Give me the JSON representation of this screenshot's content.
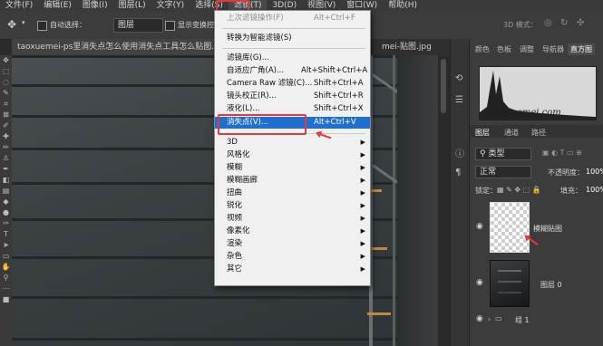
{
  "menubar": {
    "items": [
      "文件(F)",
      "编辑(E)",
      "图像(I)",
      "图层(L)",
      "文字(Y)",
      "选择(S)",
      "滤镜(T)",
      "3D(D)",
      "视图(V)",
      "窗口(W)",
      "帮助(H)"
    ],
    "active": "滤镜(T)"
  },
  "options": {
    "auto_select_label": "自动选择：",
    "layer_select_value": "图层",
    "show_transform_label": "显示变换控件",
    "mode_3d_label": "3D 模式："
  },
  "tabs": {
    "doc_tab": "taoxuemei-ps里消失点怎么使用消失点工具怎么贴图.psd",
    "doc_tab2": "mei-贴图.jpg"
  },
  "filter_menu": {
    "items": [
      {
        "label": "上次滤镜操作(F)",
        "shortcut": "Alt+Ctrl+F",
        "disabled": true
      },
      {
        "label": "转换为智能滤镜(S)"
      },
      {
        "label": "滤镜库(G)..."
      },
      {
        "label": "自适应广角(A)...",
        "shortcut": "Alt+Shift+Ctrl+A"
      },
      {
        "label": "Camera Raw 滤镜(C)...",
        "shortcut": "Shift+Ctrl+A"
      },
      {
        "label": "镜头校正(R)...",
        "shortcut": "Shift+Ctrl+R"
      },
      {
        "label": "液化(L)...",
        "shortcut": "Shift+Ctrl+X"
      },
      {
        "label": "消失点(V)...",
        "shortcut": "Alt+Ctrl+V",
        "highlighted": true
      },
      {
        "label": "3D",
        "submenu": true
      },
      {
        "label": "风格化",
        "submenu": true
      },
      {
        "label": "模糊",
        "submenu": true
      },
      {
        "label": "模糊画廊",
        "submenu": true
      },
      {
        "label": "扭曲",
        "submenu": true
      },
      {
        "label": "锐化",
        "submenu": true
      },
      {
        "label": "视频",
        "submenu": true
      },
      {
        "label": "像素化",
        "submenu": true
      },
      {
        "label": "渲染",
        "submenu": true
      },
      {
        "label": "杂色",
        "submenu": true
      },
      {
        "label": "其它",
        "submenu": true
      }
    ]
  },
  "panel": {
    "top_tabs": [
      "颜色",
      "色板",
      "调整",
      "导航器",
      "直方图"
    ],
    "active_top_tab": "直方图",
    "watermark": "Taoxuemei.com",
    "layer_tabs": [
      "图层",
      "通道",
      "路径"
    ],
    "filter_type": "类型",
    "blend_mode": "正常",
    "opacity_label": "不透明度：",
    "opacity_value": "100%",
    "lock_label": "锁定：",
    "fill_label": "填充：",
    "fill_value": "100%",
    "layers": [
      {
        "name": "模糊贴图"
      },
      {
        "name": "图层 0"
      },
      {
        "name": "组 1"
      }
    ]
  },
  "colors": {
    "highlight": "#1f6fd1",
    "annotation_red": "#e0393e"
  }
}
